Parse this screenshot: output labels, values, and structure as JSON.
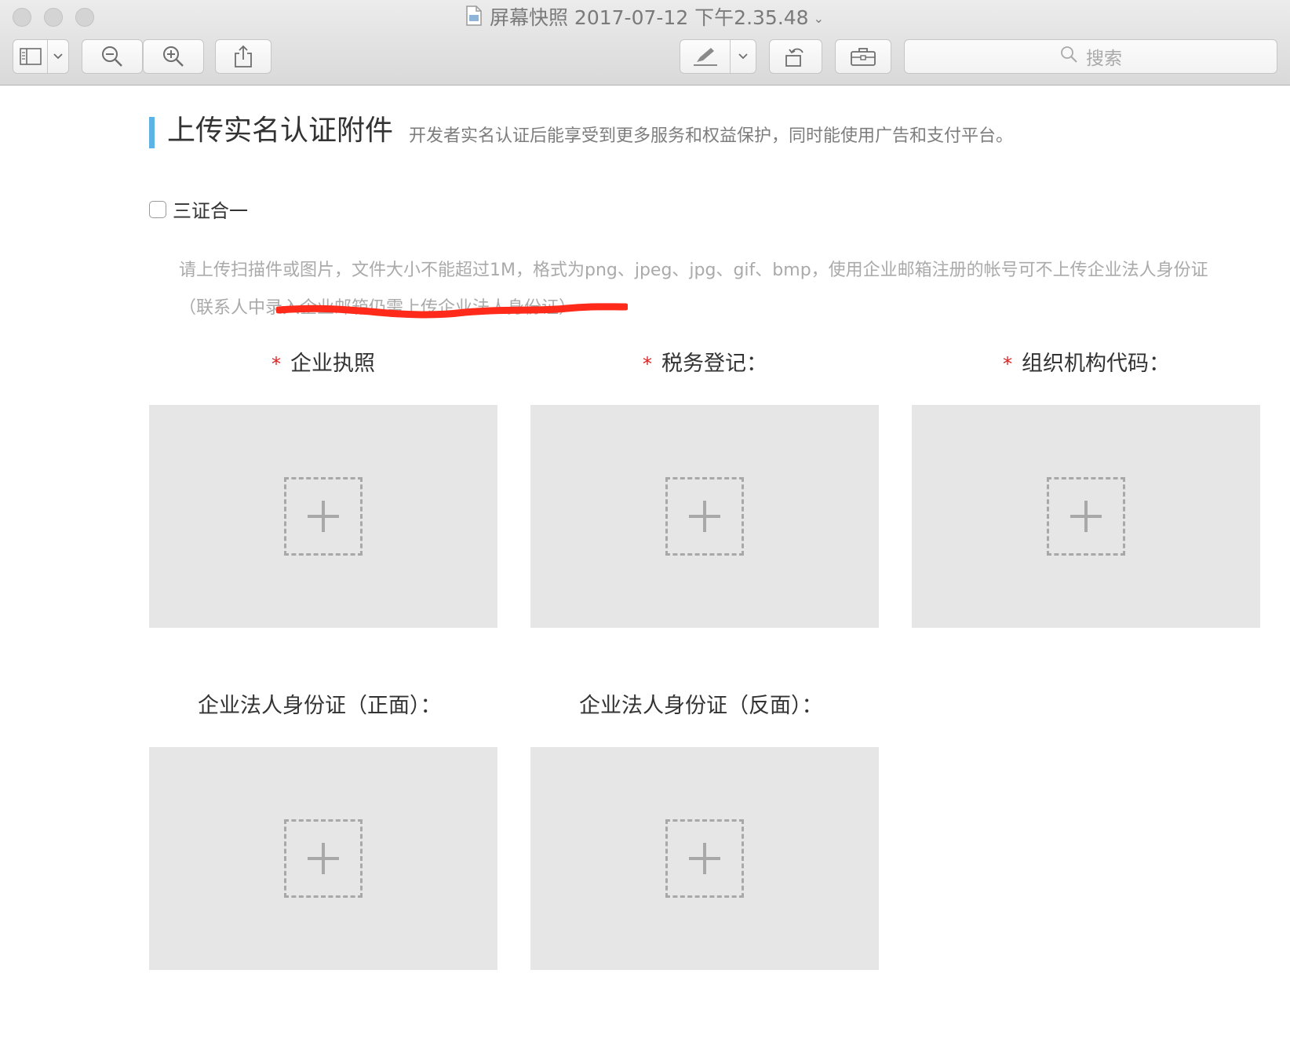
{
  "window": {
    "title": "屏幕快照 2017-07-12 下午2.35.48",
    "title_icon": "document-icon",
    "search_placeholder": "搜索"
  },
  "toolbar": {
    "icons": [
      "sidebar-icon",
      "chevron-down-icon",
      "zoom-out-icon",
      "zoom-in-icon",
      "share-icon",
      "markup-icon",
      "chevron-down-icon",
      "rotate-icon",
      "toolbox-icon"
    ]
  },
  "section": {
    "title": "上传实名认证附件",
    "subtitle": "开发者实名认证后能享受到更多服务和权益保护，同时能使用广告和支付平台。"
  },
  "checkbox": {
    "label": "三证合一",
    "checked": false
  },
  "notice": {
    "line1": "请上传扫描件或图片，文件大小不能超过1M，格式为png、jpeg、jpg、gif、bmp，使用企业邮箱注册的帐号可不上传企业法人身份证",
    "line2": "（联系人中录入企业邮箱仍需上传企业法人身份证）",
    "annotation_color": "#ff2a1a"
  },
  "uploads": [
    {
      "label": "企业执照",
      "required": true,
      "required_mark": "*"
    },
    {
      "label": "税务登记：",
      "required": true,
      "required_mark": "*"
    },
    {
      "label": "组织机构代码：",
      "required": true,
      "required_mark": "*"
    },
    {
      "label": "企业法人身份证（正面）：",
      "required": false
    },
    {
      "label": "企业法人身份证（反面）：",
      "required": false
    }
  ],
  "colors": {
    "accent_bar": "#5db3e6",
    "required": "#e02020",
    "upload_bg": "#e6e6e6"
  }
}
